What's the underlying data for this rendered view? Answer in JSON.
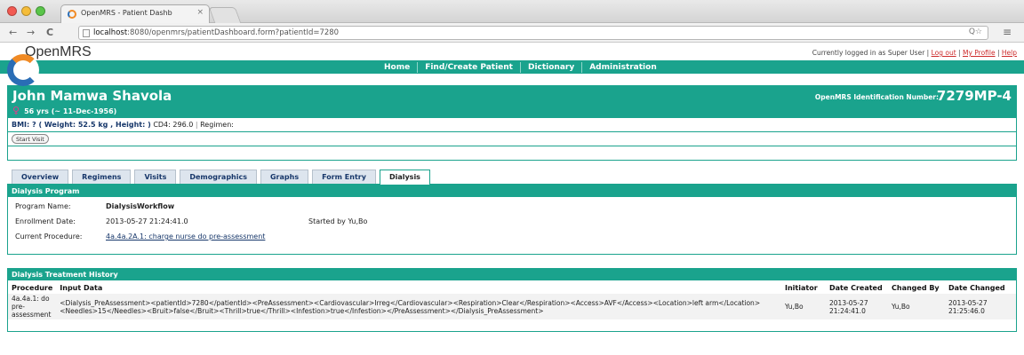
{
  "browser": {
    "tab_title": "OpenMRS - Patient Dashb",
    "tab_close": "×",
    "url_host": "localhost",
    "url_rest": ":8080/openmrs/patientDashboard.form?patientId=7280",
    "back_glyph": "←",
    "forward_glyph": "→",
    "reload_glyph": "C",
    "url_right_glyph": "Q☆",
    "menu_glyph": "≡"
  },
  "app": {
    "logo_text": "OpenMRS",
    "user_prefix": "Currently logged in as Super User",
    "log_out": "Log out",
    "my_profile": "My Profile",
    "help": "Help",
    "nav": [
      "Home",
      "Find/Create Patient",
      "Dictionary",
      "Administration"
    ]
  },
  "patient": {
    "name": "John Mamwa Shavola",
    "gender_glyph": "♀",
    "age": "56 yrs (~ 11-Dec-1956)",
    "id_label": "OpenMRS Identification Number:",
    "id_value": "7279MP-4",
    "bmi": "BMI: ? ( Weight: 52.5 kg , Height: )",
    "cd4": "CD4: 296.0",
    "regimen": "Regimen:",
    "start_visit": "Start Visit"
  },
  "tabs": [
    "Overview",
    "Regimens",
    "Visits",
    "Demographics",
    "Graphs",
    "Form Entry",
    "Dialysis"
  ],
  "active_tab": "Dialysis",
  "program": {
    "title": "Dialysis Program",
    "name_label": "Program Name:",
    "name_value": "DialysisWorkflow",
    "enroll_label": "Enrollment Date:",
    "enroll_value": "2013-05-27 21:24:41.0",
    "started_by": "Started by Yu,Bo",
    "proc_label": "Current Procedure:",
    "proc_value": "4a.4a.2A.1: charge nurse do pre-assessment"
  },
  "history": {
    "title": "Dialysis Treatment History",
    "columns": [
      "Procedure",
      "Input Data",
      "Initiator",
      "Date Created",
      "Changed By",
      "Date Changed"
    ],
    "rows": [
      {
        "procedure": "4a.4a.1: do pre-assessment",
        "input": "<Dialysis_PreAssessment><patientId>7280</patientId><PreAssessment><Cardiovascular>Irreg</Cardiovascular><Respiration>Clear</Respiration><Access>AVF</Access><Location>left arm</Location><Needles>15</Needles><Bruit>false</Bruit><Thrill>true</Thrill><Infestion>true</Infestion></PreAssessment></Dialysis_PreAssessment>",
        "initiator": "Yu,Bo",
        "date_created": "2013-05-27 21:24:41.0",
        "changed_by": "Yu,Bo",
        "date_changed": "2013-05-27 21:25:46.0"
      }
    ]
  },
  "colors": {
    "accent": "#1aa38d",
    "link": "#17376a"
  }
}
